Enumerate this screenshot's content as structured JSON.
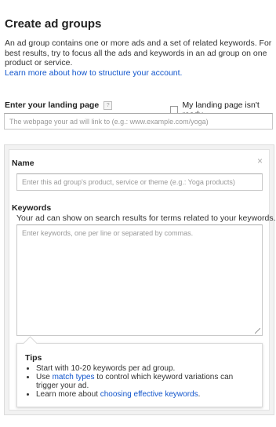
{
  "header": {
    "title": "Create ad groups",
    "intro_text": "An ad group contains one or more ads and a set of related keywords. For best results, try to focus all the ads and keywords in an ad group on one product or service.",
    "learn_more_link": "Learn more about how to structure your account."
  },
  "landing_page": {
    "label": "Enter your landing page",
    "help_icon": "question-mark-icon",
    "checkbox_label": "My landing page isn't ready",
    "checkbox_checked": false,
    "input_placeholder": "The webpage your ad will link to (e.g.: www.example.com/yoga)",
    "input_value": ""
  },
  "ad_group_panel": {
    "close_icon": "close-icon",
    "name": {
      "label": "Name",
      "placeholder": "Enter this ad group's product, service or theme (e.g.: Yoga products)",
      "value": ""
    },
    "keywords": {
      "label": "Keywords",
      "description": "Your ad can show on search results for terms related to your keywords.",
      "placeholder": "Enter keywords, one per line or separated by commas.",
      "value": ""
    },
    "tips": {
      "title": "Tips",
      "item1": "Start with 10-20 keywords per ad group.",
      "item2_prefix": "Use ",
      "item2_link": "match types",
      "item2_suffix": " to control which keyword variations can trigger your ad.",
      "item3_prefix": "Learn more about ",
      "item3_link": "choosing effective keywords",
      "item3_suffix": "."
    }
  },
  "colors": {
    "link": "#1155cc",
    "panel_background": "#f2f2f2",
    "input_border": "#c8c8c8"
  }
}
